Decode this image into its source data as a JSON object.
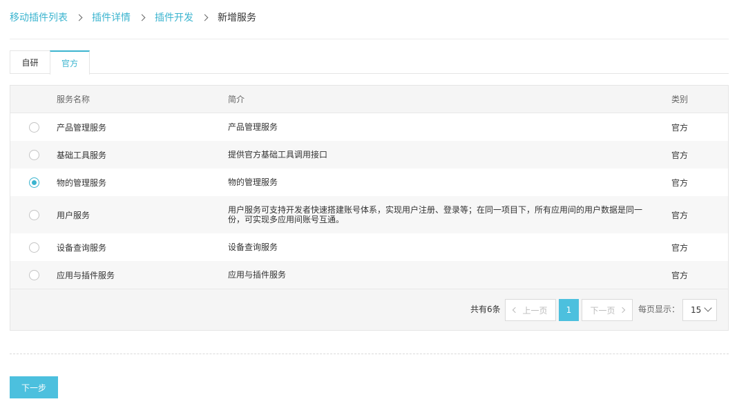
{
  "breadcrumb": {
    "items": [
      "移动插件列表",
      "插件详情",
      "插件开发"
    ],
    "current": "新增服务"
  },
  "tabs": [
    "自研",
    "官方"
  ],
  "active_tab": "官方",
  "table": {
    "headers": {
      "name": "服务名称",
      "desc": "简介",
      "type": "类别"
    },
    "rows": [
      {
        "name": "产品管理服务",
        "desc": "产品管理服务",
        "type": "官方",
        "selected": false
      },
      {
        "name": "基础工具服务",
        "desc": "提供官方基础工具调用接口",
        "type": "官方",
        "selected": false
      },
      {
        "name": "物的管理服务",
        "desc": "物的管理服务",
        "type": "官方",
        "selected": true
      },
      {
        "name": "用户服务",
        "desc": "用户服务可支持开发者快速搭建账号体系，实现用户注册、登录等；在同一项目下，所有应用间的用户数据是同一份，可实现多应用间账号互通。",
        "type": "官方",
        "selected": false
      },
      {
        "name": "设备查询服务",
        "desc": "设备查询服务",
        "type": "官方",
        "selected": false
      },
      {
        "name": "应用与插件服务",
        "desc": "应用与插件服务",
        "type": "官方",
        "selected": false
      }
    ]
  },
  "pagination": {
    "total": "共有6条",
    "prev": "上一页",
    "current_page": "1",
    "next": "下一页",
    "per_page_label": "每页显示：",
    "per_page_value": "15"
  },
  "footer": {
    "next_step": "下一步"
  },
  "colors": {
    "accent": "#3bb4cf",
    "button": "#4cc0de"
  }
}
